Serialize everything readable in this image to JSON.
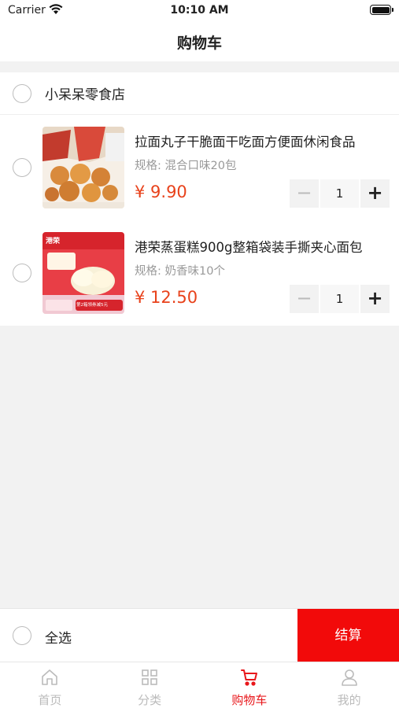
{
  "status_bar": {
    "carrier": "Carrier",
    "time": "10:10 AM"
  },
  "nav": {
    "title": "购物车"
  },
  "shop": {
    "name": "小呆呆零食店"
  },
  "items": [
    {
      "title": "拉面丸子干脆面干吃面方便面休闲食品",
      "spec": "规格: 混合口味20包",
      "price": "¥ 9.90",
      "qty": "1",
      "image_icon": "noodle-snack-product-image"
    },
    {
      "title": "港荣蒸蛋糕900g整箱袋装手撕夹心面包",
      "spec": "规格: 奶香味10个",
      "price": "¥ 12.50",
      "qty": "1",
      "image_icon": "steamed-cake-product-image",
      "image_text": {
        "brand": "港荣",
        "badge": "第2箱领券减5元"
      }
    }
  ],
  "stepper": {
    "minus": "−",
    "plus": "+"
  },
  "footer": {
    "select_all": "全选",
    "checkout": "结算"
  },
  "tabs": [
    {
      "label": "首页",
      "icon": "home-icon"
    },
    {
      "label": "分类",
      "icon": "category-grid-icon"
    },
    {
      "label": "购物车",
      "icon": "cart-icon",
      "active": true
    },
    {
      "label": "我的",
      "icon": "user-icon"
    }
  ],
  "colors": {
    "accent": "#e8171b",
    "price": "#e8421b",
    "checkout_bg": "#f20a0a",
    "background": "#f2f2f2"
  }
}
